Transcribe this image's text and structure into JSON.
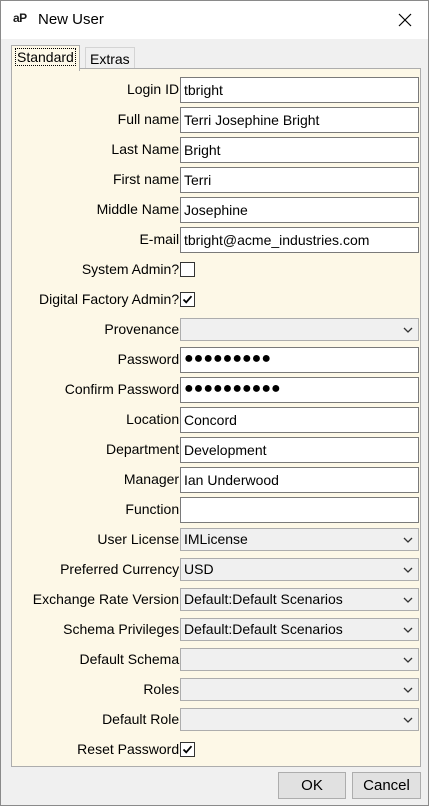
{
  "window": {
    "title": "New User",
    "app_icon": "aP"
  },
  "tabs": [
    {
      "label": "Standard",
      "active": true
    },
    {
      "label": "Extras",
      "active": false
    }
  ],
  "form": {
    "login_id": {
      "label": "Login ID:",
      "value": "tbright"
    },
    "full_name": {
      "label": "Full name:",
      "value": "Terri Josephine Bright"
    },
    "last_name": {
      "label": "Last Name:",
      "value": "Bright"
    },
    "first_name": {
      "label": "First name:",
      "value": "Terri"
    },
    "middle_name": {
      "label": "Middle Name:",
      "value": "Josephine"
    },
    "email": {
      "label": "E-mail:",
      "value": "tbright@acme_industries.com"
    },
    "system_admin": {
      "label": "System Admin?:",
      "checked": false
    },
    "digital_factory_admin": {
      "label": "Digital Factory Admin?:",
      "checked": true
    },
    "provenance": {
      "label": "Provenance:",
      "value": ""
    },
    "password": {
      "label": "Password:",
      "value": "●●●●●●●●●"
    },
    "confirm_password": {
      "label": "Confirm Password:",
      "value": "●●●●●●●●●●"
    },
    "location": {
      "label": "Location:",
      "value": "Concord"
    },
    "department": {
      "label": "Department:",
      "value": "Development"
    },
    "manager": {
      "label": "Manager:",
      "value": "Ian Underwood"
    },
    "function": {
      "label": "Function:",
      "value": ""
    },
    "user_license": {
      "label": "User License:",
      "value": "IMLicense"
    },
    "preferred_currency": {
      "label": "Preferred Currency:",
      "value": "USD"
    },
    "exchange_rate_version": {
      "label": "Exchange Rate Version:",
      "value": "Default:Default Scenarios"
    },
    "schema_privileges": {
      "label": "Schema Privileges:",
      "value": "Default:Default Scenarios"
    },
    "default_schema": {
      "label": "Default Schema:",
      "value": ""
    },
    "roles": {
      "label": "Roles:",
      "value": ""
    },
    "default_role": {
      "label": "Default Role:",
      "value": ""
    },
    "reset_password": {
      "label": "Reset Password:",
      "checked": true
    }
  },
  "buttons": {
    "ok": "OK",
    "cancel": "Cancel"
  }
}
